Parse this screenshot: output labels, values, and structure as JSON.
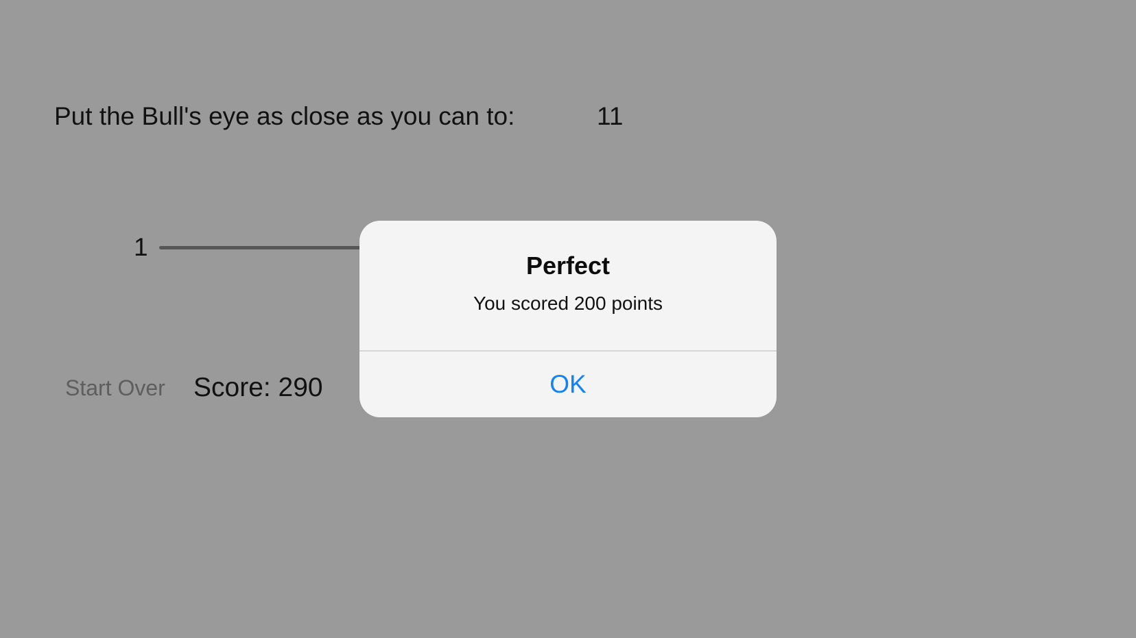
{
  "game": {
    "instruction": "Put the Bull's eye as close as you can to:",
    "target_value": "11",
    "slider_min_label": "1",
    "start_over_label": "Start Over",
    "score_text": "Score: 290"
  },
  "alert": {
    "title": "Perfect",
    "message": "You scored 200 points",
    "ok_label": "OK"
  },
  "colors": {
    "background_dimmed": "#9a9a9a",
    "alert_background": "#f4f4f4",
    "ok_button_tint": "#1482f0"
  }
}
